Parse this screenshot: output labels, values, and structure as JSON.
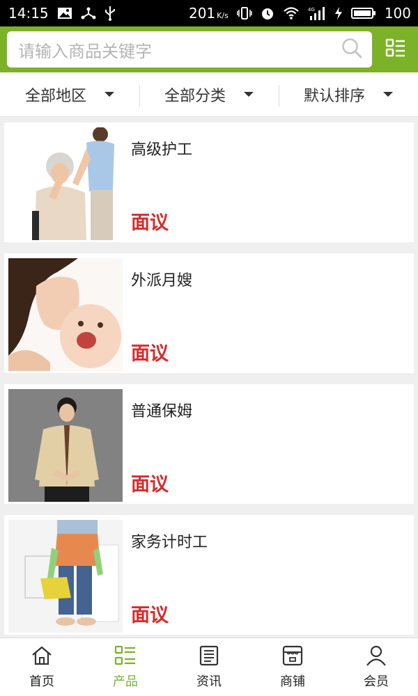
{
  "status_bar": {
    "time": "14:15",
    "speed_value": "201",
    "speed_unit": "K/s",
    "battery": "100",
    "icons": [
      "image-icon",
      "share-icon",
      "usb-icon",
      "vibrate-icon",
      "alarm-icon",
      "wifi-icon",
      "4g-signal-icon",
      "charging-icon",
      "battery-icon"
    ]
  },
  "search": {
    "placeholder": "请输入商品关键字",
    "icon": "search-icon",
    "menu_icon": "category-menu-icon"
  },
  "filters": [
    {
      "label": "全部地区"
    },
    {
      "label": "全部分类"
    },
    {
      "label": "默认排序"
    }
  ],
  "products": [
    {
      "title": "高级护工",
      "price": "面议",
      "image": "caregiver-elderly-photo"
    },
    {
      "title": "外派月嫂",
      "price": "面议",
      "image": "mother-baby-photo"
    },
    {
      "title": "普通保姆",
      "price": "面议",
      "image": "nanny-uniform-photo"
    },
    {
      "title": "家务计时工",
      "price": "面议",
      "image": "housework-cleaning-photo"
    }
  ],
  "bottom_nav": [
    {
      "label": "首页",
      "icon": "home-icon",
      "active": false
    },
    {
      "label": "产品",
      "icon": "product-list-icon",
      "active": true
    },
    {
      "label": "资讯",
      "icon": "news-icon",
      "active": false
    },
    {
      "label": "商铺",
      "icon": "store-icon",
      "active": false
    },
    {
      "label": "会员",
      "icon": "user-icon",
      "active": false
    }
  ],
  "colors": {
    "brand_green": "#7cb228",
    "price_red": "#d62c2c",
    "background": "#efefef"
  }
}
